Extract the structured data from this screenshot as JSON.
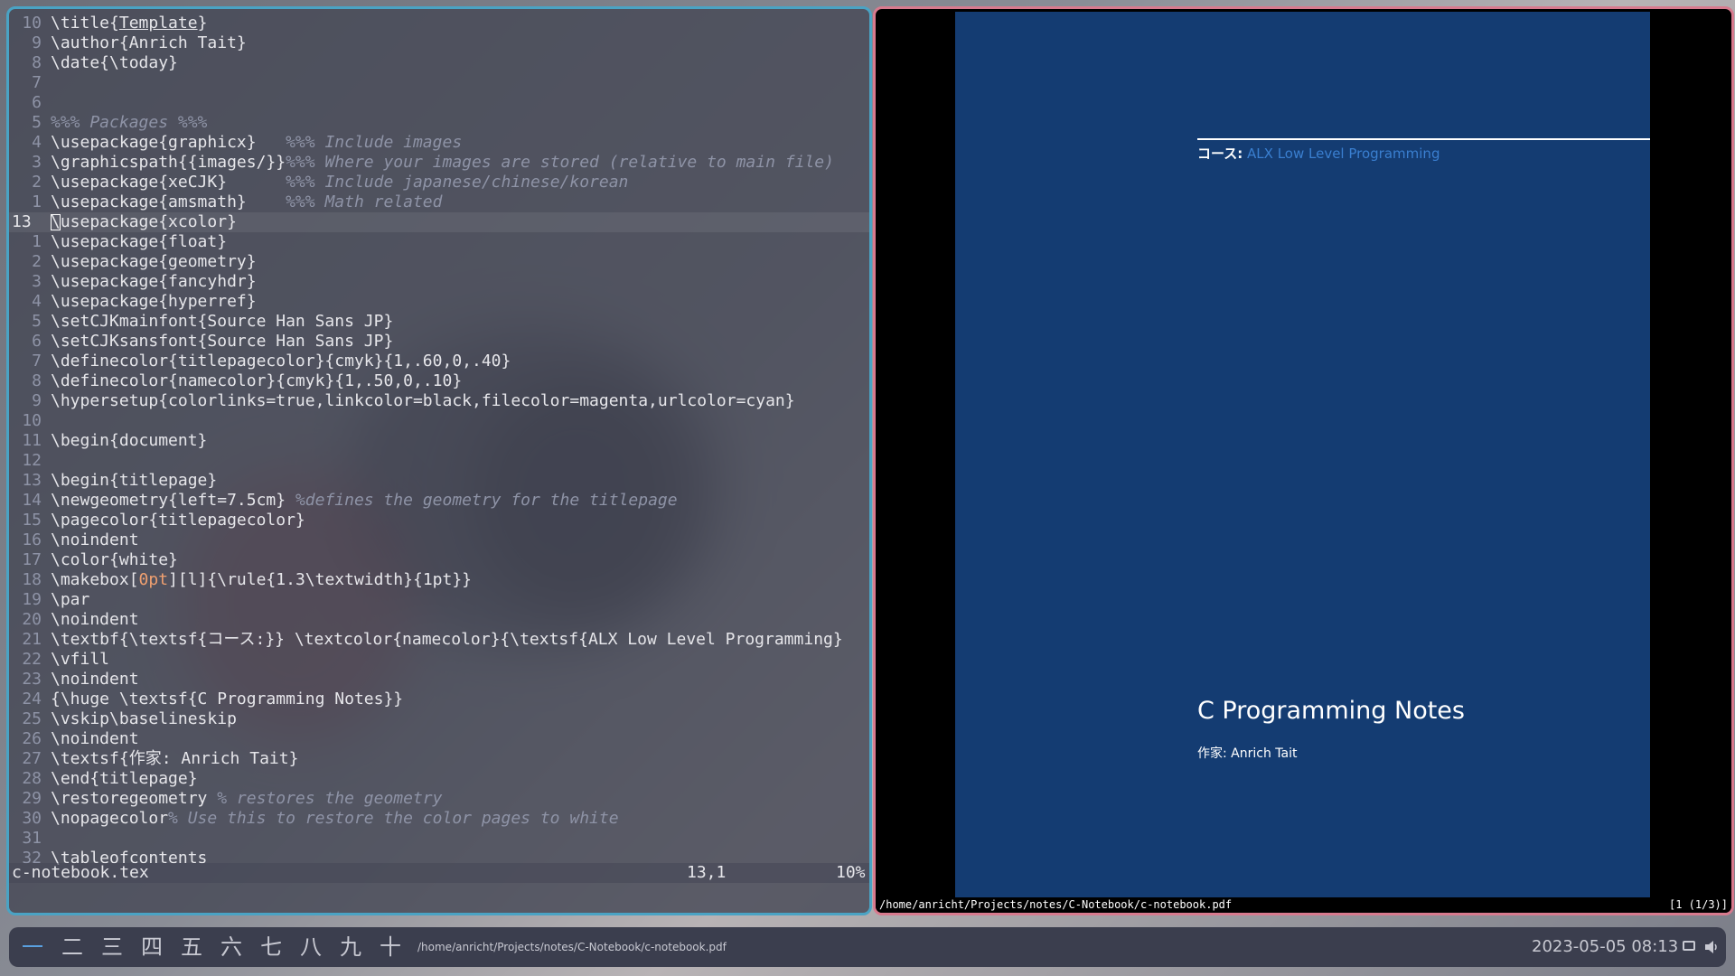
{
  "editor": {
    "lines": [
      {
        "num": "10",
        "segments": [
          {
            "t": "\\title{"
          },
          {
            "t": "Template",
            "u": true
          },
          {
            "t": "}"
          }
        ]
      },
      {
        "num": "9",
        "segments": [
          {
            "t": "\\author{Anrich Tait}"
          }
        ]
      },
      {
        "num": "8",
        "segments": [
          {
            "t": "\\date{\\today}"
          }
        ]
      },
      {
        "num": "7",
        "segments": []
      },
      {
        "num": "6",
        "segments": []
      },
      {
        "num": "5",
        "segments": [
          {
            "t": "%%% Packages %%%",
            "c": "comment"
          }
        ]
      },
      {
        "num": "4",
        "segments": [
          {
            "t": "\\usepackage{graphicx}   "
          },
          {
            "t": "%%% Include images",
            "c": "comment"
          }
        ]
      },
      {
        "num": "3",
        "segments": [
          {
            "t": "\\graphicspath{{images/}}"
          },
          {
            "t": "%%% Where your images are stored (relative to main file)",
            "c": "comment"
          }
        ]
      },
      {
        "num": "2",
        "segments": [
          {
            "t": "\\usepackage{xeCJK}      "
          },
          {
            "t": "%%% Include japanese/chinese/korean",
            "c": "comment"
          }
        ]
      },
      {
        "num": "1",
        "segments": [
          {
            "t": "\\usepackage{amsmath}    "
          },
          {
            "t": "%%% Math related",
            "c": "comment"
          }
        ]
      },
      {
        "num": "13",
        "current": true,
        "segments": [
          {
            "t": "\\usepackage{xcolor}"
          }
        ]
      },
      {
        "num": "1",
        "segments": [
          {
            "t": "\\usepackage{float}"
          }
        ]
      },
      {
        "num": "2",
        "segments": [
          {
            "t": "\\usepackage{geometry}"
          }
        ]
      },
      {
        "num": "3",
        "segments": [
          {
            "t": "\\usepackage{fancyhdr}"
          }
        ]
      },
      {
        "num": "4",
        "segments": [
          {
            "t": "\\usepackage{hyperref}"
          }
        ]
      },
      {
        "num": "5",
        "segments": [
          {
            "t": "\\setCJKmainfont{Source Han Sans JP}"
          }
        ]
      },
      {
        "num": "6",
        "segments": [
          {
            "t": "\\setCJKsansfont{Source Han Sans JP}"
          }
        ]
      },
      {
        "num": "7",
        "segments": [
          {
            "t": "\\definecolor{titlepagecolor}{cmyk}{1,.60,0,.40}"
          }
        ]
      },
      {
        "num": "8",
        "segments": [
          {
            "t": "\\definecolor{namecolor}{cmyk}{1,.50,0,.10}"
          }
        ]
      },
      {
        "num": "9",
        "segments": [
          {
            "t": "\\hypersetup{colorlinks=true,linkcolor=black,filecolor=magenta,urlcolor=cyan}"
          }
        ]
      },
      {
        "num": "10",
        "segments": []
      },
      {
        "num": "11",
        "segments": [
          {
            "t": "\\begin{document}"
          }
        ]
      },
      {
        "num": "12",
        "segments": []
      },
      {
        "num": "13",
        "segments": [
          {
            "t": "\\begin{titlepage}"
          }
        ]
      },
      {
        "num": "14",
        "segments": [
          {
            "t": "\\newgeometry{left=7.5cm} "
          },
          {
            "t": "%defines the geometry for the titlepage",
            "c": "comment"
          }
        ]
      },
      {
        "num": "15",
        "segments": [
          {
            "t": "\\pagecolor{titlepagecolor}"
          }
        ]
      },
      {
        "num": "16",
        "segments": [
          {
            "t": "\\noindent"
          }
        ]
      },
      {
        "num": "17",
        "segments": [
          {
            "t": "\\color{white}"
          }
        ]
      },
      {
        "num": "18",
        "segments": [
          {
            "t": "\\makebox["
          },
          {
            "t": "0pt",
            "c": "num"
          },
          {
            "t": "][l]{\\rule{1.3\\textwidth}{1pt}}"
          }
        ]
      },
      {
        "num": "19",
        "segments": [
          {
            "t": "\\par"
          }
        ]
      },
      {
        "num": "20",
        "segments": [
          {
            "t": "\\noindent"
          }
        ]
      },
      {
        "num": "21",
        "segments": [
          {
            "t": "\\textbf{\\textsf{コース:}} \\textcolor{namecolor}{\\textsf{ALX Low Level Programming}"
          }
        ]
      },
      {
        "num": "22",
        "segments": [
          {
            "t": "\\vfill"
          }
        ]
      },
      {
        "num": "23",
        "segments": [
          {
            "t": "\\noindent"
          }
        ]
      },
      {
        "num": "24",
        "segments": [
          {
            "t": "{\\huge \\textsf{C Programming Notes}}"
          }
        ]
      },
      {
        "num": "25",
        "segments": [
          {
            "t": "\\vskip\\baselineskip"
          }
        ]
      },
      {
        "num": "26",
        "segments": [
          {
            "t": "\\noindent"
          }
        ]
      },
      {
        "num": "27",
        "segments": [
          {
            "t": "\\textsf{作家: Anrich Tait}"
          }
        ]
      },
      {
        "num": "28",
        "segments": [
          {
            "t": "\\end{titlepage}"
          }
        ]
      },
      {
        "num": "29",
        "segments": [
          {
            "t": "\\restoregeometry "
          },
          {
            "t": "% restores the geometry",
            "c": "comment"
          }
        ]
      },
      {
        "num": "30",
        "segments": [
          {
            "t": "\\nopagecolor"
          },
          {
            "t": "% Use this to restore the color pages to white",
            "c": "comment"
          }
        ]
      },
      {
        "num": "31",
        "segments": []
      },
      {
        "num": "32",
        "segments": [
          {
            "t": "\\tableofcontents"
          }
        ]
      }
    ],
    "status": {
      "filename": "c-notebook.tex",
      "position": "13,1",
      "percent": "10%"
    }
  },
  "viewer": {
    "pdf": {
      "course_label": "コース:",
      "course_value": "ALX Low Level Programming",
      "title": "C Programming Notes",
      "author": "作家: Anrich Tait"
    },
    "status": {
      "path": "/home/anricht/Projects/notes/C-Notebook/c-notebook.pdf",
      "page": "[1 (1/3)]"
    }
  },
  "taskbar": {
    "workspaces": [
      "一",
      "二",
      "三",
      "四",
      "五",
      "六",
      "七",
      "八",
      "九",
      "十"
    ],
    "active_workspace": 0,
    "window_title": "/home/anricht/Projects/notes/C-Notebook/c-notebook.pdf",
    "clock": "2023-05-05 08:13",
    "icons": [
      "monitor-icon",
      "volume-icon"
    ]
  },
  "colors": {
    "editor_border": "#4aa3c4",
    "viewer_border": "#d87a8e",
    "pdf_page_bg": "#143c72",
    "namecolor": "#3a7fd0",
    "active_workspace": "#5aa0e0"
  }
}
